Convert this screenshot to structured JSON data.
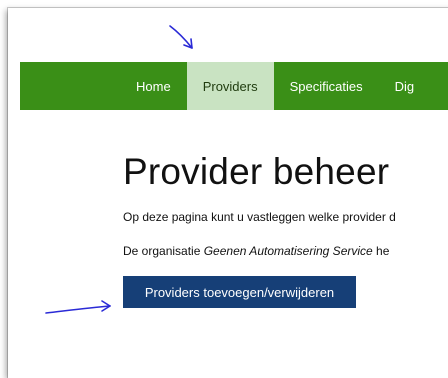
{
  "nav": {
    "items": [
      {
        "label": "Home",
        "active": false
      },
      {
        "label": "Providers",
        "active": true
      },
      {
        "label": "Specificaties",
        "active": false
      },
      {
        "label": "Dig",
        "active": false
      }
    ]
  },
  "main": {
    "title": "Provider beheer",
    "line1": "Op deze pagina kunt u vastleggen welke provider d",
    "line2_prefix": "De organisatie ",
    "line2_org": "Geenen Automatisering Service",
    "line2_suffix": " he",
    "button_label": "Providers toevoegen/verwijderen"
  },
  "colors": {
    "nav_bg": "#3a8f17",
    "nav_active_bg": "#c9e3c2",
    "button_bg": "#163f77",
    "arrow": "#2a2ad6"
  },
  "icons": [
    "arrow-annotation-icon"
  ]
}
